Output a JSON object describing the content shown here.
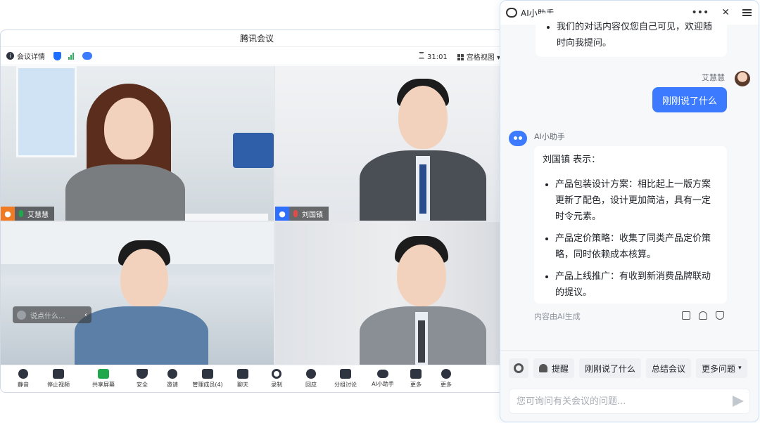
{
  "meeting": {
    "title": "腾讯会议",
    "meeting_details": "会议详情",
    "timer": "31:01",
    "view_mode": "宫格视图",
    "participants": [
      {
        "name": "艾慧慧",
        "tag_color": "#f07b22",
        "mic_color": "#1fa84b"
      },
      {
        "name": "刘国镇",
        "tag_color": "#2f6fff",
        "mic_color": "#e24b4b"
      }
    ],
    "chat_placeholder": "说点什么...",
    "toolbar": [
      {
        "label": "静音",
        "icon": "microphone-icon",
        "caret": true
      },
      {
        "label": "停止视频",
        "icon": "camera-icon",
        "caret": true
      },
      {
        "label": "共享屏幕",
        "icon": "share-screen-icon",
        "caret": true
      },
      {
        "label": "安全",
        "icon": "shield-icon",
        "caret": false
      },
      {
        "label": "邀请",
        "icon": "invite-user-icon",
        "caret": false
      },
      {
        "label": "管理成员(4)",
        "icon": "members-icon",
        "caret": false
      },
      {
        "label": "聊天",
        "icon": "chat-icon",
        "caret": false
      },
      {
        "label": "录制",
        "icon": "record-icon",
        "caret": true
      },
      {
        "label": "回应",
        "icon": "reaction-icon",
        "caret": true
      },
      {
        "label": "分组讨论",
        "icon": "breakout-icon",
        "caret": false
      },
      {
        "label": "AI小助手",
        "icon": "ai-assistant-icon",
        "caret": true
      },
      {
        "label": "更多",
        "icon": "apps-icon",
        "caret": false
      },
      {
        "label": "更多",
        "icon": "settings-icon",
        "caret": false
      }
    ]
  },
  "assistant": {
    "title": "AI小助手",
    "prev_message": "我们的对话内容仅您自己可见，欢迎随时向我提问。",
    "user_name": "艾慧慧",
    "user_message": "刚刚说了什么",
    "ai_name": "AI小助手",
    "ai_reply": {
      "intro": "刘国镇 表示：",
      "points": [
        "产品包装设计方案：相比起上一版方案更新了配色，设计更加简洁，具有一定时令元素。",
        "产品定价策略：收集了同类产品定价策略，同时依赖成本核算。",
        "产品上线推广：有收到新消费品牌联动的提议。"
      ]
    },
    "generated_note": "内容由AI生成",
    "quick_actions": [
      "提醒",
      "刚刚说了什么",
      "总结会议",
      "更多问题"
    ],
    "input_placeholder": "您可询问有关会议的问题...",
    "accent_color": "#3c7bff"
  }
}
